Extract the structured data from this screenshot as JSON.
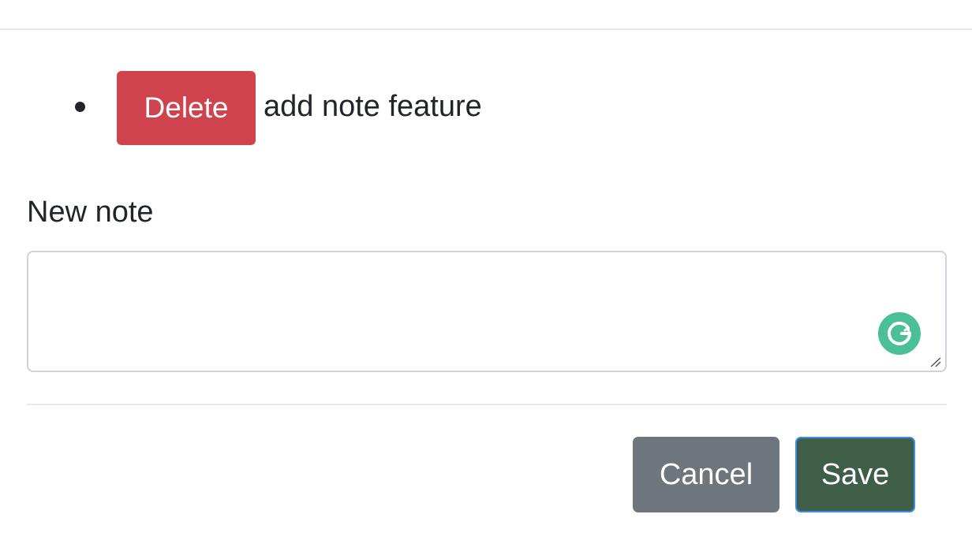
{
  "notes": {
    "items": [
      {
        "delete_label": "Delete",
        "text": "add note feature"
      }
    ]
  },
  "form": {
    "label": "New note",
    "textarea_value": "",
    "grammarly_icon": "grammarly-icon"
  },
  "actions": {
    "cancel_label": "Cancel",
    "save_label": "Save"
  },
  "colors": {
    "danger": "#cf434f",
    "secondary": "#6e757d",
    "save": "#3f5e48",
    "focus_ring": "#3b8de5",
    "grammarly": "#4bbf98"
  }
}
